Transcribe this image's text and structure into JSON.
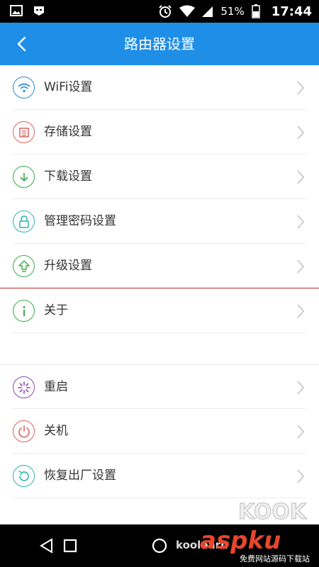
{
  "status_bar": {
    "battery_percent": "51%",
    "time": "17:44"
  },
  "app_bar": {
    "title": "路由器设置"
  },
  "settings": {
    "items": [
      {
        "label": "WiFi设置",
        "icon": "wifi-icon",
        "color": "#2f86d4"
      },
      {
        "label": "存储设置",
        "icon": "storage-icon",
        "color": "#e0605c"
      },
      {
        "label": "下载设置",
        "icon": "download-icon",
        "color": "#3aaa4a"
      },
      {
        "label": "管理密码设置",
        "icon": "lock-icon",
        "color": "#2bb3b8"
      },
      {
        "label": "升级设置",
        "icon": "upgrade-icon",
        "color": "#3aaa4a"
      },
      {
        "label": "关于",
        "icon": "info-icon",
        "color": "#3aaa4a"
      }
    ],
    "power_items": [
      {
        "label": "重启",
        "icon": "restart-icon",
        "color": "#8e44ad"
      },
      {
        "label": "关机",
        "icon": "power-icon",
        "color": "#e0605c"
      },
      {
        "label": "恢复出厂设置",
        "icon": "factory-reset-icon",
        "color": "#2bb3b8"
      }
    ]
  },
  "watermark": {
    "koolearn": "koolearn",
    "asp": "aspku",
    "sub": "免费网站源码下载站",
    "kook": "KOOK"
  },
  "colors": {
    "app_bar": "#1f8ee6",
    "accent_divider": "#b72b2b"
  }
}
